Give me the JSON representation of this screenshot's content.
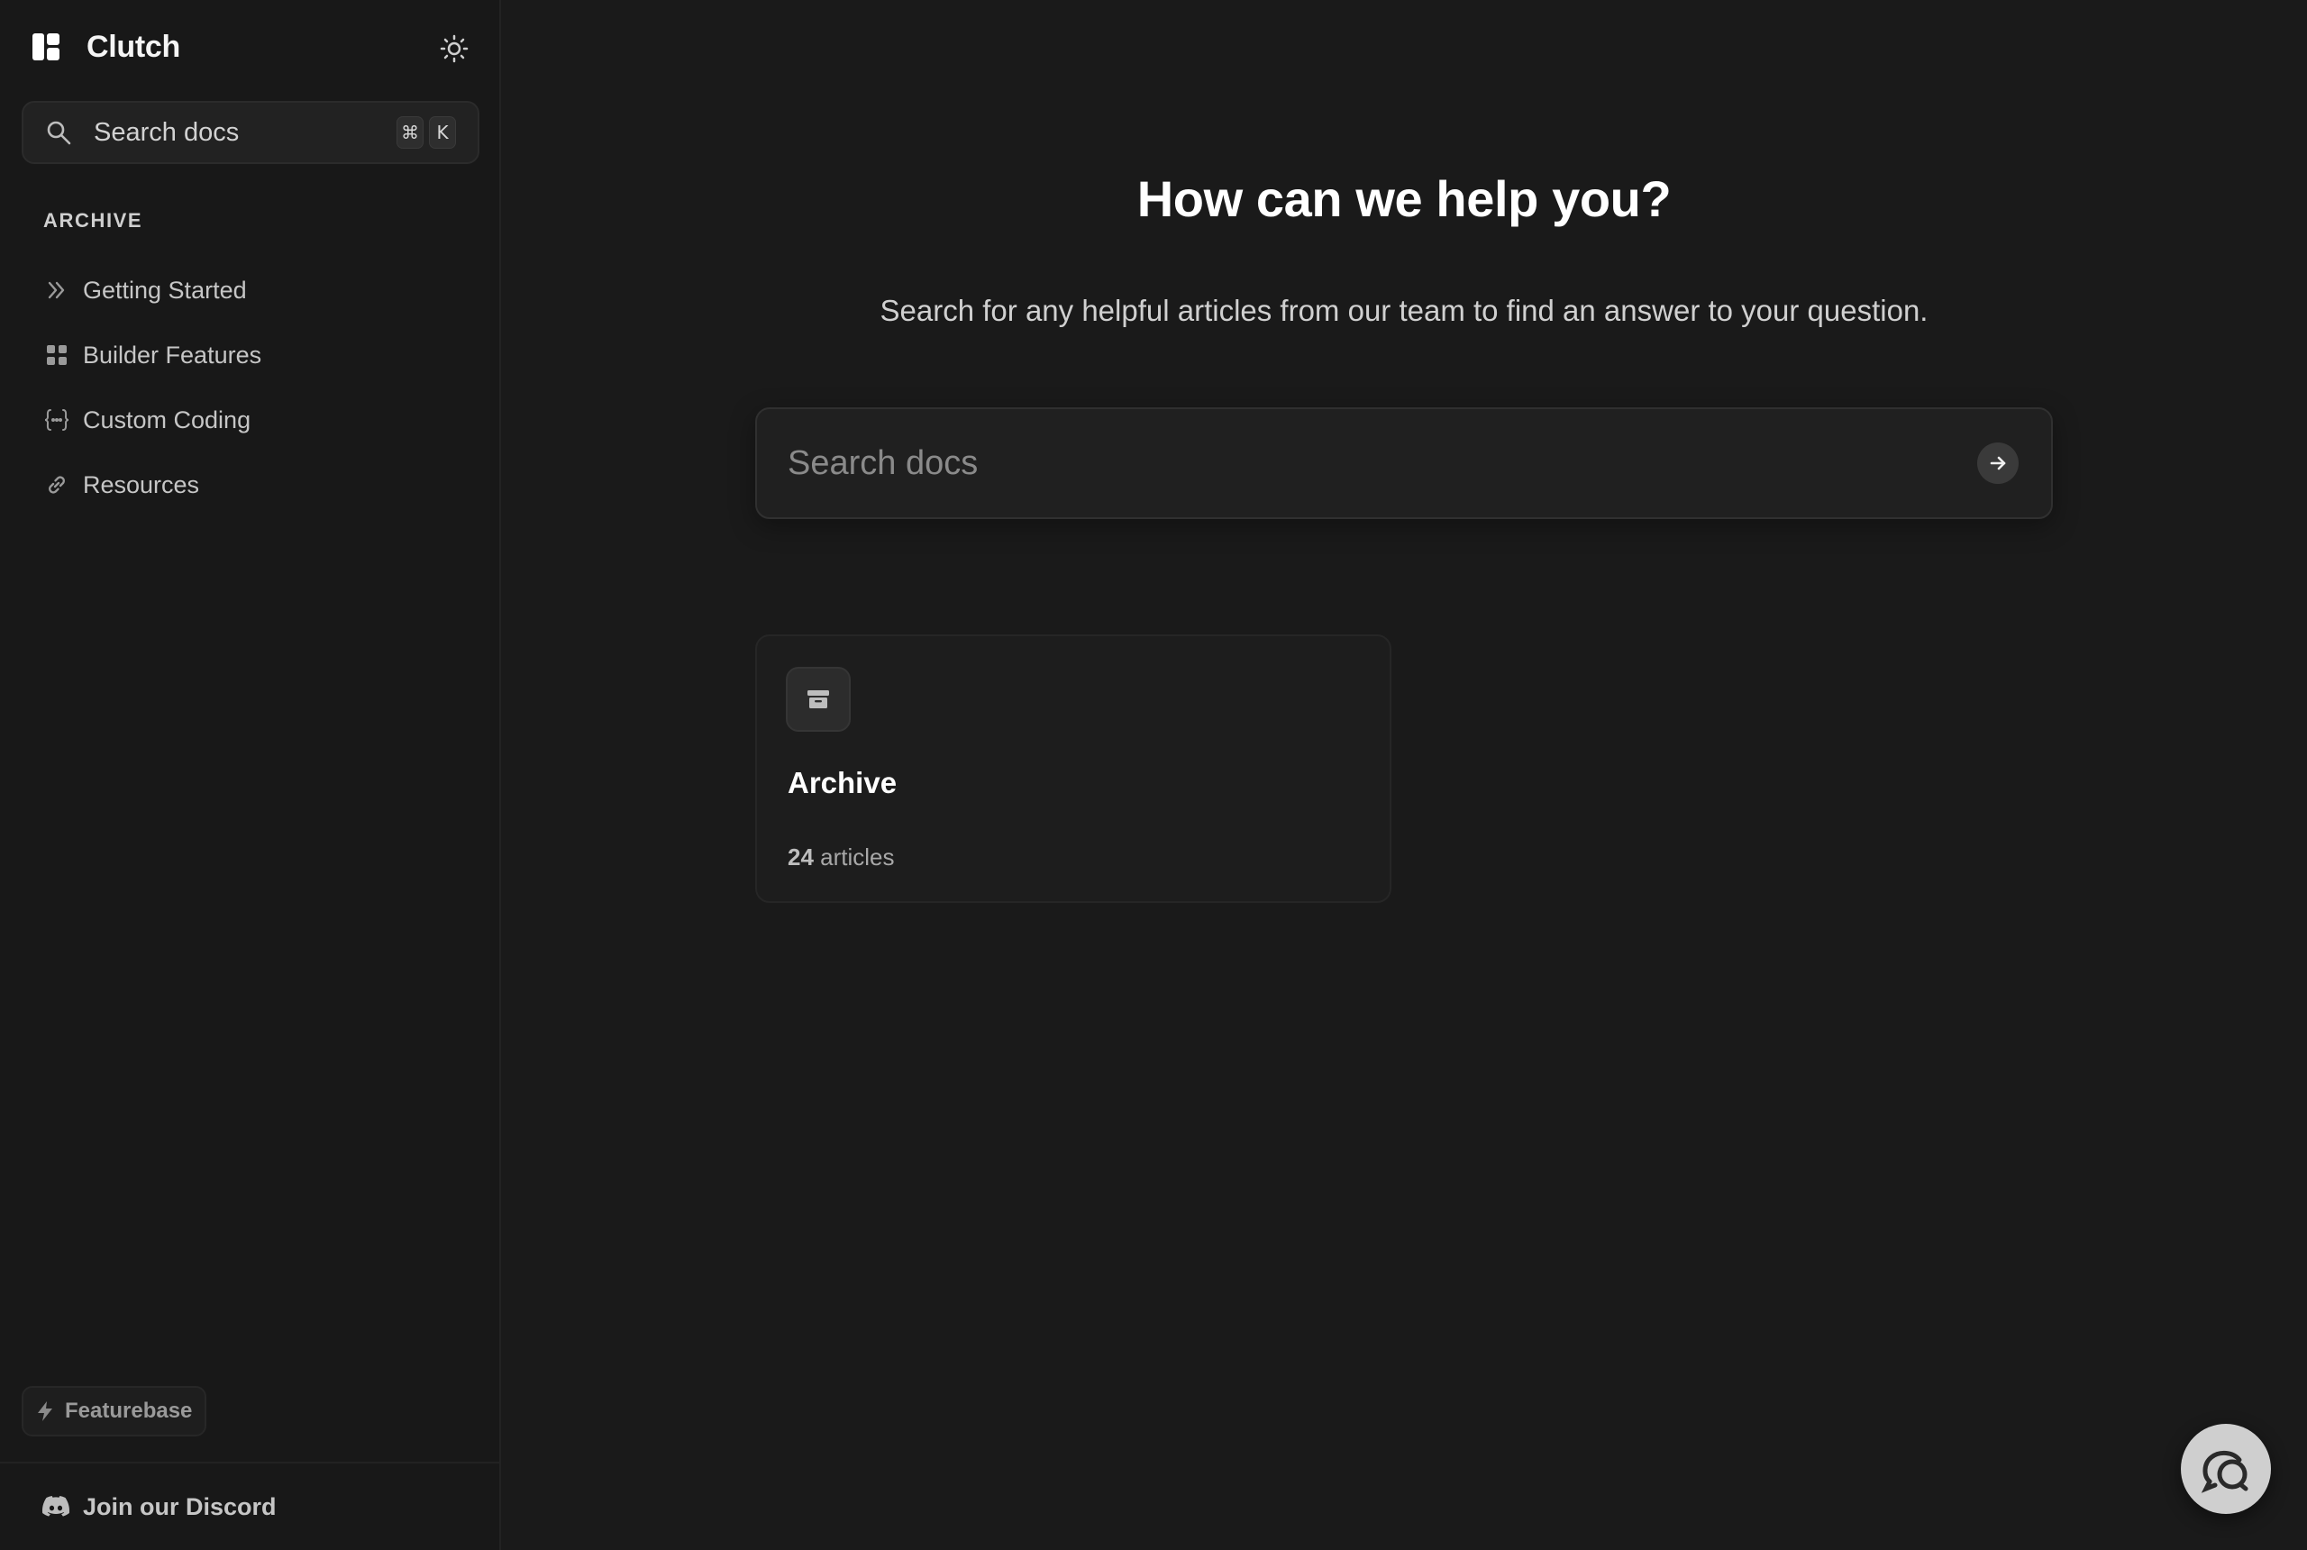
{
  "brand": {
    "name": "Clutch",
    "icon": "layout-panels-icon"
  },
  "sidebar": {
    "search": {
      "label": "Search docs",
      "kbd_meta": "⌘",
      "kbd_key": "K"
    },
    "section_title": "ARCHIVE",
    "items": [
      {
        "label": "Getting Started",
        "icon": "chevrons-right-icon"
      },
      {
        "label": "Builder Features",
        "icon": "grid-icon"
      },
      {
        "label": "Custom Coding",
        "icon": "code-braces-icon"
      },
      {
        "label": "Resources",
        "icon": "link-icon"
      }
    ],
    "featurebase_label": "Featurebase",
    "discord_label": "Join our Discord"
  },
  "main": {
    "title": "How can we help you?",
    "subtitle": "Search for any helpful articles from our team to find an answer to your question.",
    "search": {
      "placeholder": "Search docs"
    },
    "collections": [
      {
        "title": "Archive",
        "count": "24",
        "count_suffix": "articles",
        "icon": "archive-box-icon"
      }
    ]
  },
  "colors": {
    "background": "#1a1a1a",
    "sidebar": "#181818",
    "text_primary": "#ffffff",
    "text_muted": "#c6c6c6",
    "chat_launcher": "#cfcfcf"
  }
}
